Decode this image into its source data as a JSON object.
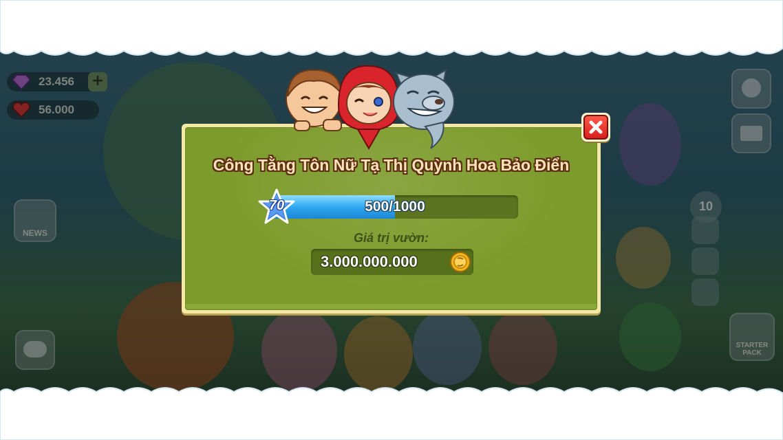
{
  "hud": {
    "gems": "23.456",
    "hearts": "56.000",
    "news_label": "NEWS",
    "badge_count": "10",
    "pack_label": "STARTER PACK"
  },
  "dialog": {
    "title": "Công Tằng Tôn Nữ Tạ Thị Quỳnh Hoa Bảo Điển",
    "level": "70",
    "xp_text": "500/1000",
    "xp_fraction": 0.5,
    "value_label": "Giá trị vườn:",
    "value_amount": "3.000.000.000",
    "icons": {
      "level": "star-icon",
      "currency": "coin-icon",
      "close": "close-icon"
    }
  },
  "colors": {
    "panel_green": "#7d9b2c",
    "panel_border": "#f4e8a6",
    "xp_blue": "#2fa8f0",
    "close_red": "#d81f1f"
  }
}
